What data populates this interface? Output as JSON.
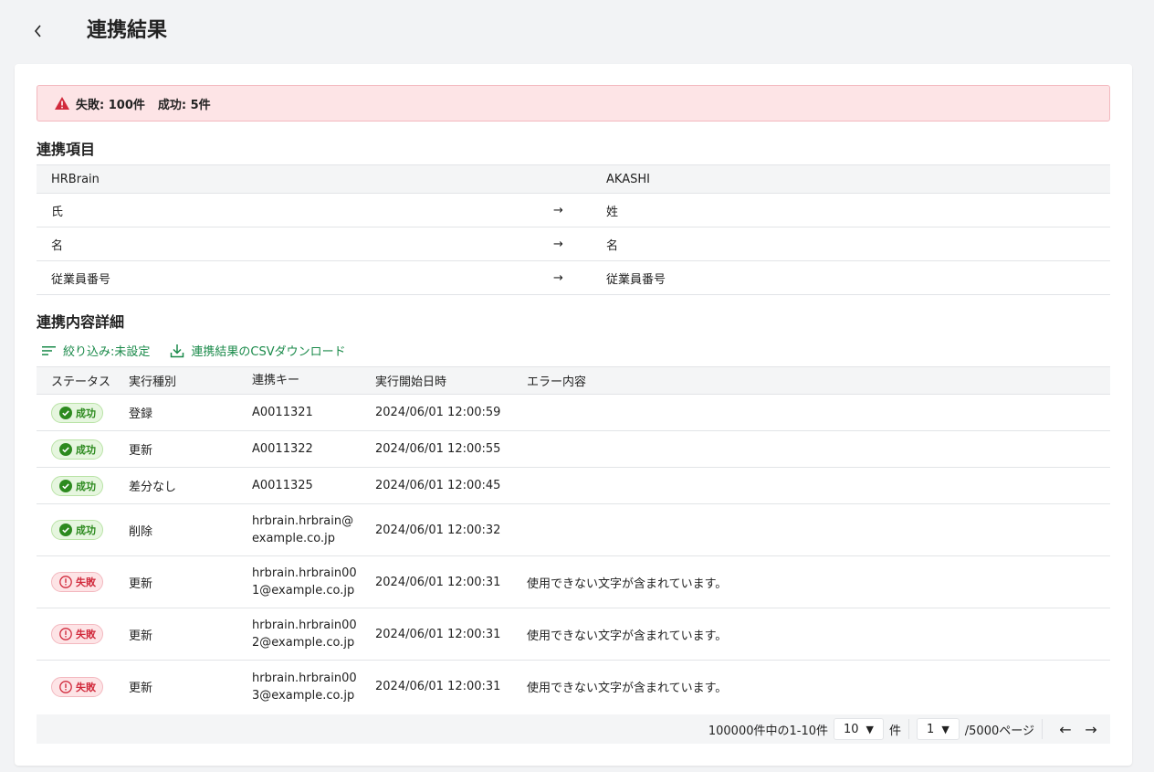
{
  "header": {
    "title": "連携結果"
  },
  "alert": {
    "failed": "失敗: 100件",
    "success": "成功: 5件"
  },
  "mapping": {
    "title": "連携項目",
    "head": {
      "source": "HRBrain",
      "target": "AKASHI"
    },
    "rows": [
      {
        "source": "氏",
        "arrow": "→",
        "target": "姓"
      },
      {
        "source": "名",
        "arrow": "→",
        "target": "名"
      },
      {
        "source": "従業員番号",
        "arrow": "→",
        "target": "従業員番号"
      }
    ]
  },
  "details": {
    "title": "連携内容詳細",
    "filter_label": "絞り込み:未設定",
    "download_label": "連携結果のCSVダウンロード",
    "columns": [
      "ステータス",
      "実行種別",
      "連携キー",
      "実行開始日時",
      "エラー内容"
    ],
    "rows": [
      {
        "status": "成功",
        "type": "登録",
        "key1": "A0011321",
        "key2": "",
        "datetime": "2024/06/01 12:00:59",
        "error": ""
      },
      {
        "status": "成功",
        "type": "更新",
        "key1": "A0011322",
        "key2": "",
        "datetime": "2024/06/01 12:00:55",
        "error": ""
      },
      {
        "status": "成功",
        "type": "差分なし",
        "key1": "A0011325",
        "key2": "",
        "datetime": "2024/06/01 12:00:45",
        "error": ""
      },
      {
        "status": "成功",
        "type": "削除",
        "key1": "hrbrain.hrbrain@",
        "key2": "example.co.jp",
        "datetime": "2024/06/01 12:00:32",
        "error": ""
      },
      {
        "status": "失敗",
        "type": "更新",
        "key1": "hrbrain.hrbrain00",
        "key2": "1@example.co.jp",
        "datetime": "2024/06/01 12:00:31",
        "error": "使用できない文字が含まれています。"
      },
      {
        "status": "失敗",
        "type": "更新",
        "key1": "hrbrain.hrbrain00",
        "key2": "2@example.co.jp",
        "datetime": "2024/06/01 12:00:31",
        "error": "使用できない文字が含まれています。"
      },
      {
        "status": "失敗",
        "type": "更新",
        "key1": "hrbrain.hrbrain00",
        "key2": "3@example.co.jp",
        "datetime": "2024/06/01 12:00:31",
        "error": "使用できない文字が含まれています。"
      }
    ]
  },
  "pager": {
    "summary": "100000件中の1-10件",
    "per_page": "10",
    "per_page_unit": "件",
    "page": "1",
    "total_pages": "/5000ページ",
    "prev": "←",
    "next": "→"
  },
  "colors": {
    "accent": "#1a8a4a",
    "success": "#2c8a1e",
    "danger": "#d12a3c",
    "alert_bg": "#fde4e6"
  },
  "icons": {
    "back": "chevron-left-icon",
    "warning": "warning-triangle-icon",
    "filter": "filter-lines-icon",
    "download": "download-icon",
    "check": "check-circle-icon",
    "error": "exclamation-circle-icon"
  }
}
